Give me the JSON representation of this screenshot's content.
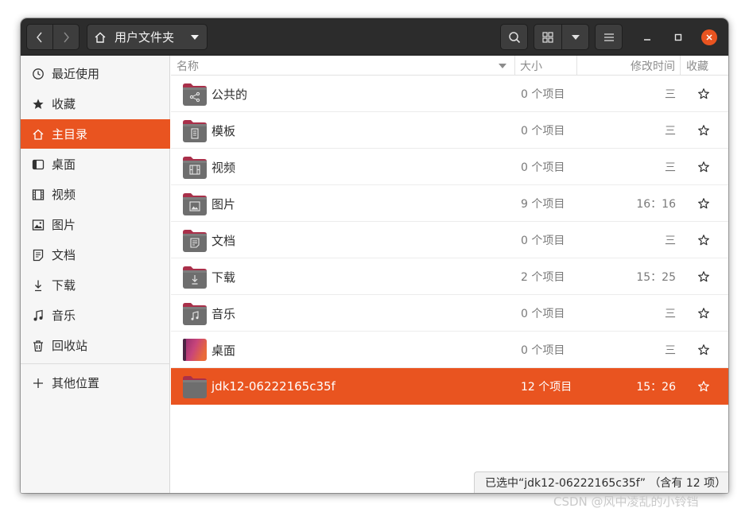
{
  "headerbar": {
    "path_label": "用户文件夹"
  },
  "sidebar": {
    "items": [
      {
        "label": "最近使用",
        "icon": "clock-icon"
      },
      {
        "label": "收藏",
        "icon": "star-icon"
      },
      {
        "label": "主目录",
        "icon": "home-icon",
        "active": true
      },
      {
        "label": "桌面",
        "icon": "desktop-icon"
      },
      {
        "label": "视频",
        "icon": "video-icon"
      },
      {
        "label": "图片",
        "icon": "image-icon"
      },
      {
        "label": "文档",
        "icon": "document-icon"
      },
      {
        "label": "下载",
        "icon": "download-icon"
      },
      {
        "label": "音乐",
        "icon": "music-icon"
      },
      {
        "label": "回收站",
        "icon": "trash-icon"
      },
      {
        "label": "其他位置",
        "icon": "plus-icon"
      }
    ]
  },
  "columns": {
    "name": "名称",
    "size": "大小",
    "modified": "修改时间",
    "starred": "收藏"
  },
  "files": [
    {
      "name": "公共的",
      "size": "0 个项目",
      "modified": "三",
      "icon": "folder-share-icon"
    },
    {
      "name": "模板",
      "size": "0 个项目",
      "modified": "三",
      "icon": "folder-templates-icon"
    },
    {
      "name": "视频",
      "size": "0 个项目",
      "modified": "三",
      "icon": "folder-videos-icon"
    },
    {
      "name": "图片",
      "size": "9 个项目",
      "modified": "16：16",
      "icon": "folder-pictures-icon"
    },
    {
      "name": "文档",
      "size": "0 个项目",
      "modified": "三",
      "icon": "folder-documents-icon"
    },
    {
      "name": "下载",
      "size": "2 个项目",
      "modified": "15：25",
      "icon": "folder-download-icon"
    },
    {
      "name": "音乐",
      "size": "0 个项目",
      "modified": "三",
      "icon": "folder-music-icon"
    },
    {
      "name": "桌面",
      "size": "0 个项目",
      "modified": "三",
      "icon": "folder-desktop-icon"
    },
    {
      "name": "jdk12-06222165c35f",
      "size": "12 个项目",
      "modified": "15：26",
      "icon": "folder-icon",
      "selected": true
    }
  ],
  "statusbar": {
    "text": "已选中“jdk12-06222165c35f” （含有 12 项）"
  },
  "watermark": "CSDN @风中凌乱的小铃铛",
  "colors": {
    "accent": "#e95420",
    "headerbar": "#2c2c2c",
    "sidebar": "#f6f6f6"
  }
}
